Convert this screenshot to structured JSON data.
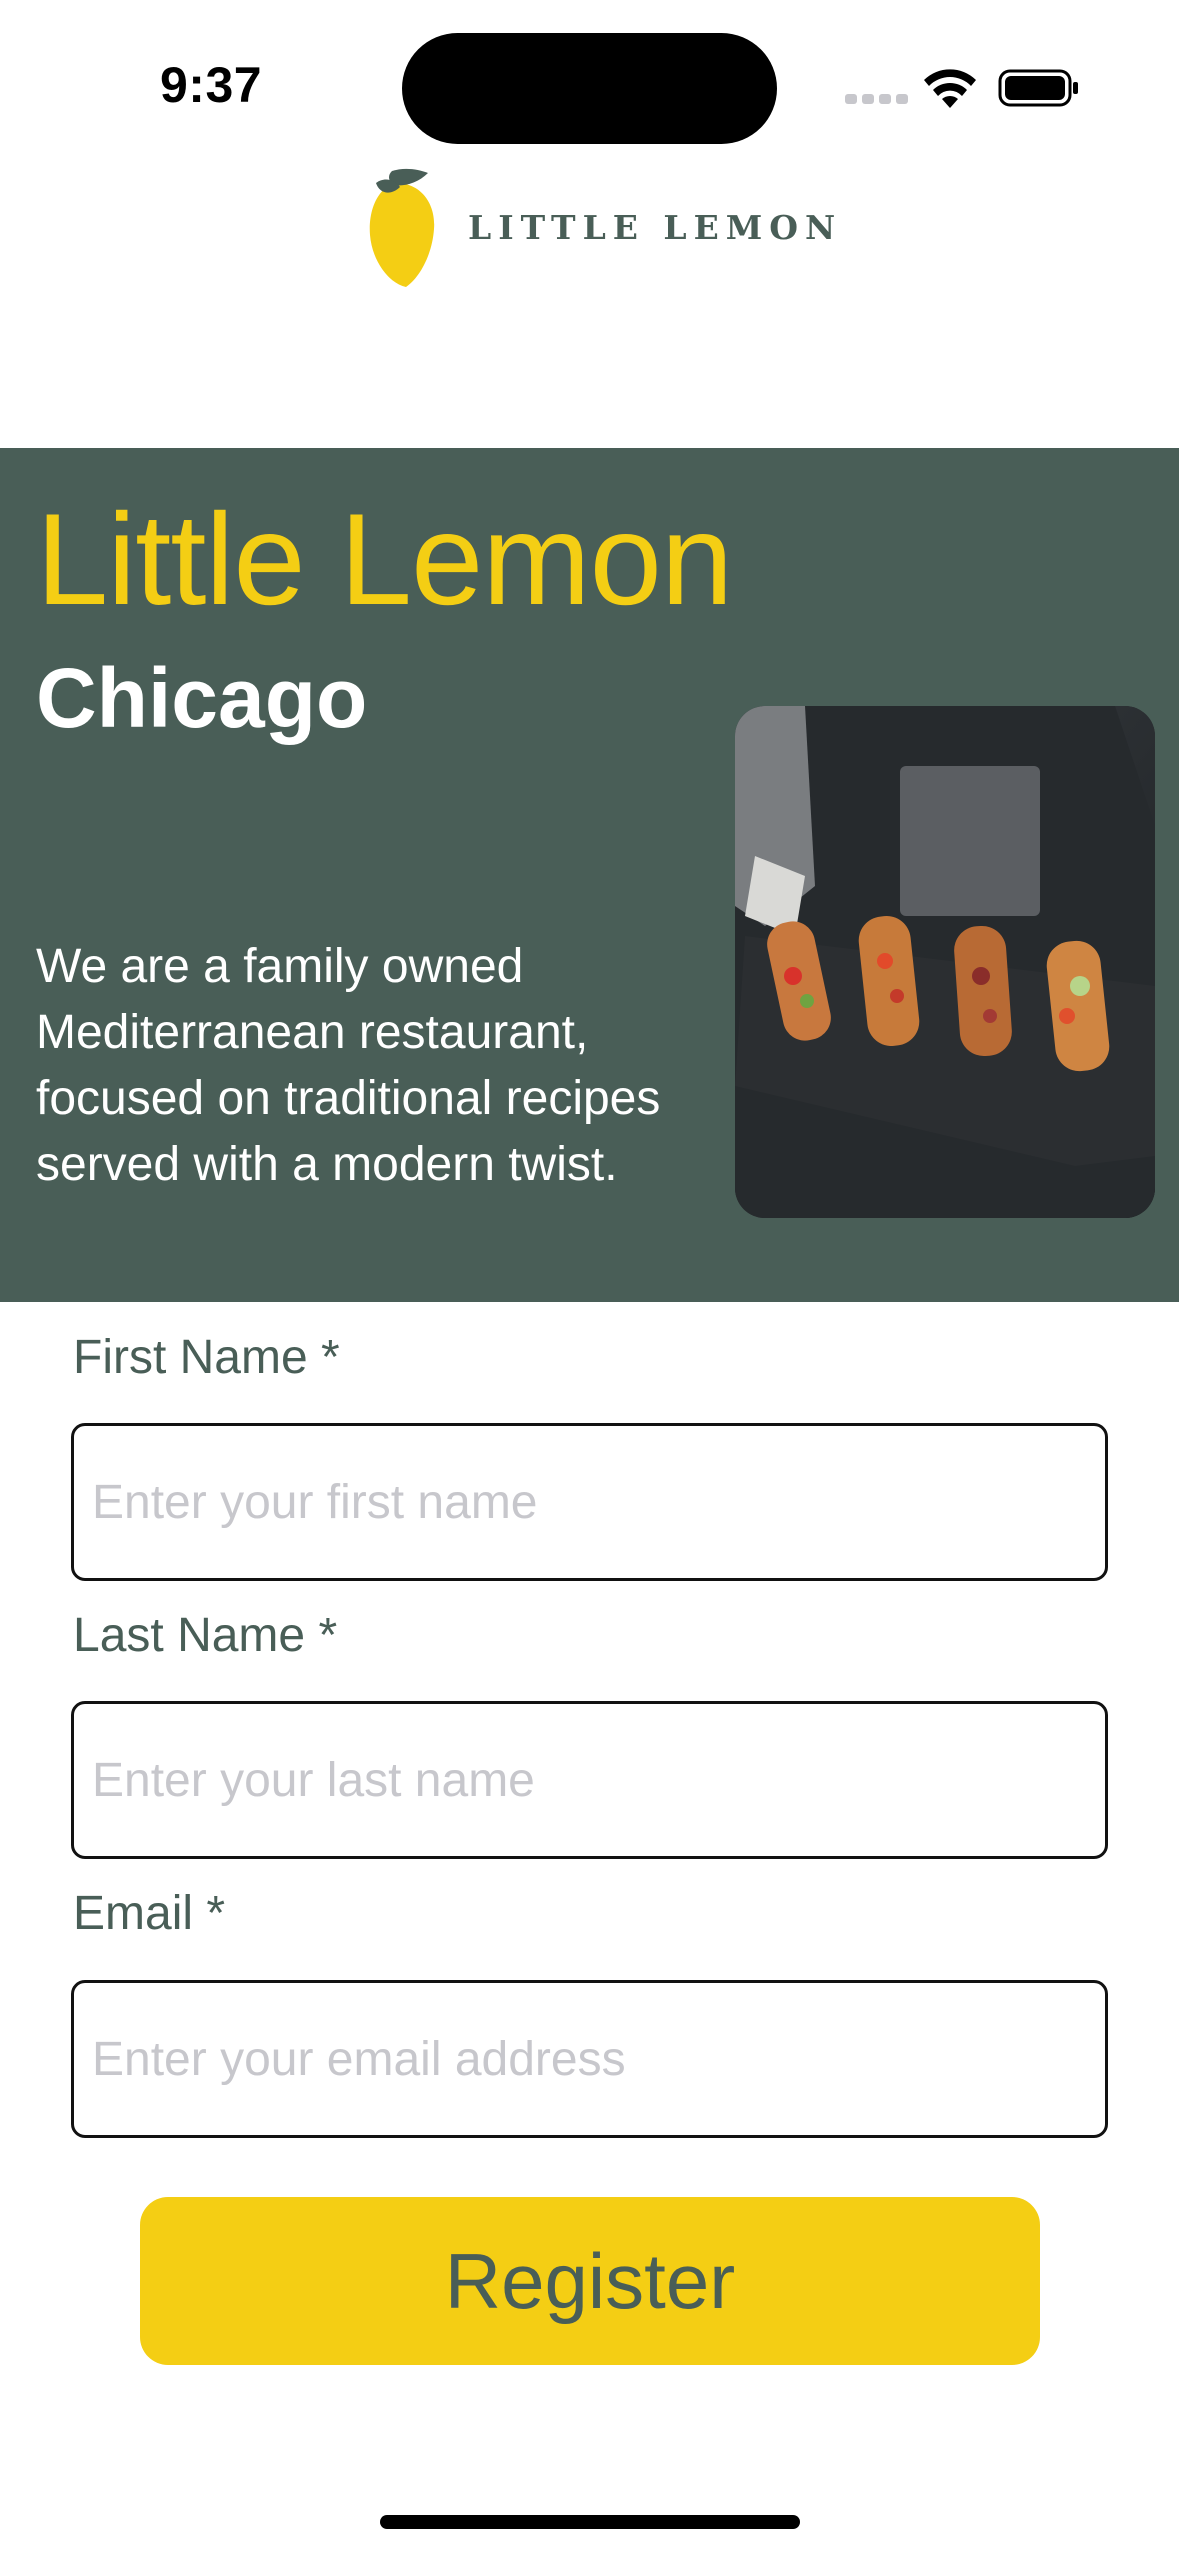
{
  "status_bar": {
    "time": "9:37"
  },
  "header": {
    "brand": "LITTLE LEMON",
    "logo_icon": "lemon-icon"
  },
  "hero": {
    "title": "Little Lemon",
    "city": "Chicago",
    "description": "We are a family owned Mediterranean restaurant, focused on traditional recipes served with a modern twist.",
    "image": "hero-food-image"
  },
  "form": {
    "first_name": {
      "label": "First Name *",
      "placeholder": "Enter your first name",
      "value": ""
    },
    "last_name": {
      "label": "Last Name *",
      "placeholder": "Enter your last name",
      "value": ""
    },
    "email": {
      "label": "Email *",
      "placeholder": "Enter your email address",
      "value": ""
    },
    "submit_label": "Register"
  },
  "colors": {
    "primary_green": "#495e57",
    "primary_yellow": "#f4ce14",
    "white": "#ffffff"
  }
}
